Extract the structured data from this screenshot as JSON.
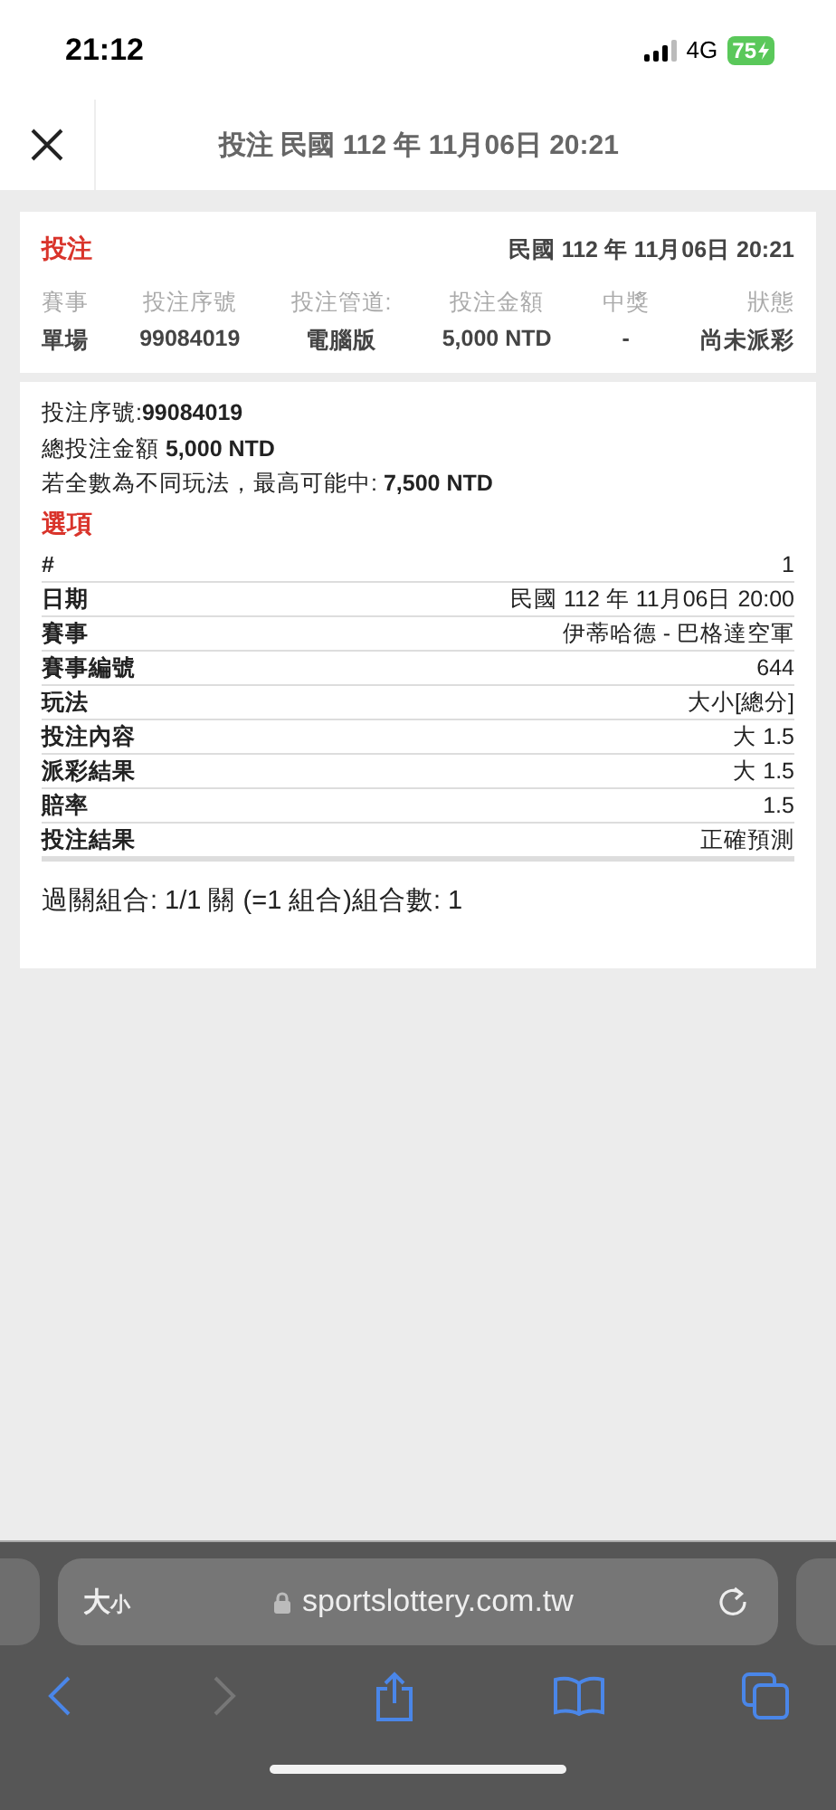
{
  "status_bar": {
    "time": "21:12",
    "network": "4G",
    "battery": "75",
    "charging": true
  },
  "header": {
    "title": "投注 民國 112 年 11月06日 20:21"
  },
  "bet_card": {
    "title": "投注",
    "datetime": "民國 112 年 11月06日 20:21",
    "columns": [
      {
        "label": "賽事",
        "value": "單場"
      },
      {
        "label": "投注序號",
        "value": "99084019"
      },
      {
        "label": "投注管道:",
        "value": "電腦版"
      },
      {
        "label": "投注金額",
        "value": "5,000 NTD"
      },
      {
        "label": "中獎",
        "value": "-"
      },
      {
        "label": "狀態",
        "value": "尚未派彩"
      }
    ]
  },
  "detail_card": {
    "summary": [
      "投注序號:**99084019**",
      "總投注金額 **5,000 NTD**",
      "若全數為不同玩法，最高可能中: **7,500 NTD**"
    ],
    "options_title": "選項",
    "rows": [
      {
        "label": "#",
        "value": "1"
      },
      {
        "label": "日期",
        "value": "民國 112 年 11月06日 20:00"
      },
      {
        "label": "賽事",
        "value": "伊蒂哈德 - 巴格達空軍"
      },
      {
        "label": "賽事編號",
        "value": "644"
      },
      {
        "label": "玩法",
        "value": "大小[總分]"
      },
      {
        "label": "投注內容",
        "value": "大 1.5"
      },
      {
        "label": "派彩結果",
        "value": "大 1.5"
      },
      {
        "label": "賠率",
        "value": "1.5"
      },
      {
        "label": "投注結果",
        "value": "正確預測"
      }
    ],
    "combo": "過關組合: 1/1 關 (=1 組合)組合數: 1"
  },
  "browser": {
    "text_size": [
      "大",
      "小"
    ],
    "url": "sportslottery.com.tw",
    "toolbar": [
      {
        "kind": "back",
        "disabled": false
      },
      {
        "kind": "forward",
        "disabled": true
      },
      {
        "kind": "share",
        "disabled": false
      },
      {
        "kind": "bookmarks",
        "disabled": false
      },
      {
        "kind": "tabs",
        "disabled": false
      }
    ]
  }
}
